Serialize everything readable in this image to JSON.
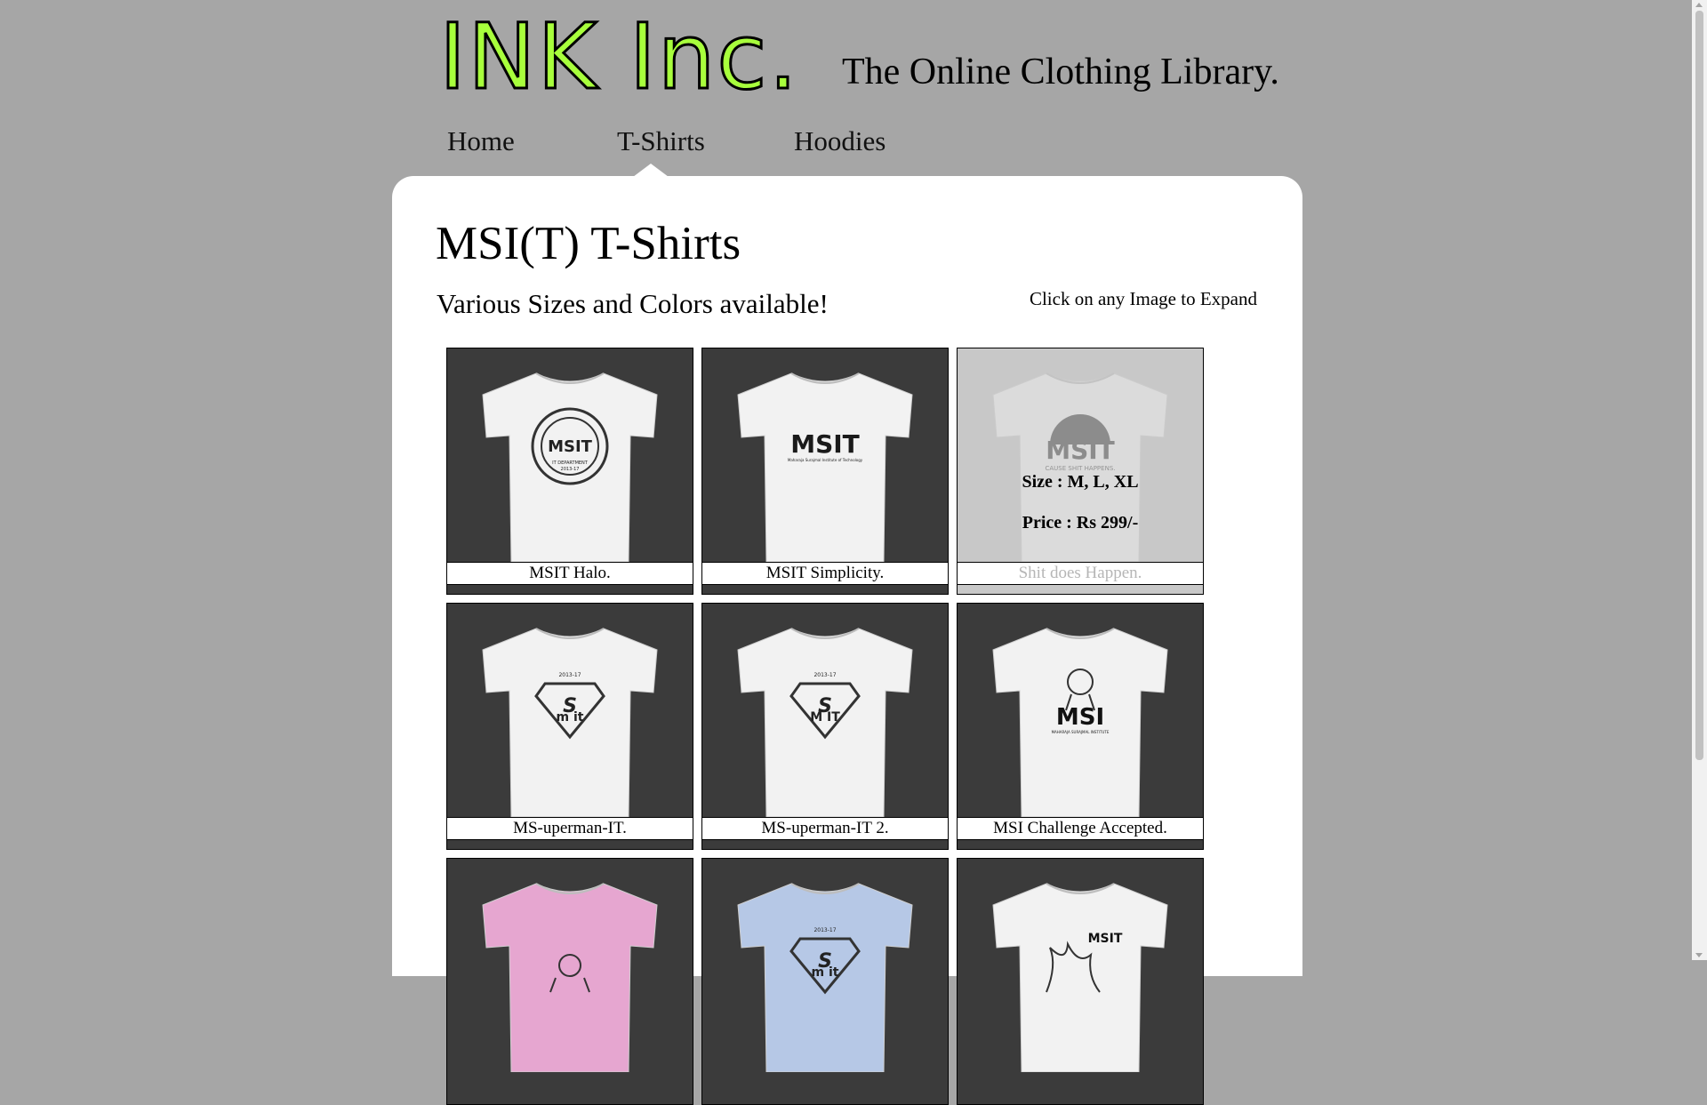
{
  "header": {
    "logo": "INK Inc.",
    "tagline": "The Online Clothing Library."
  },
  "nav": {
    "items": [
      {
        "label": "Home"
      },
      {
        "label": "T-Shirts",
        "active": true
      },
      {
        "label": "Hoodies"
      }
    ]
  },
  "main": {
    "title": "MSI(T) T-Shirts",
    "subtitle": "Various Sizes and Colors available!",
    "hint": "Click on any Image to Expand"
  },
  "gallery": {
    "items": [
      {
        "caption": "MSIT Halo.",
        "shirt_color": "#f2f2f2",
        "print": "halo"
      },
      {
        "caption": "MSIT Simplicity.",
        "shirt_color": "#f2f2f2",
        "print": "simplicity"
      },
      {
        "caption": "Shit does Happen.",
        "shirt_color": "#f2f2f2",
        "print": "happens",
        "hover": true,
        "size": "Size : M, L, XL",
        "price": "Price : Rs 299/-"
      },
      {
        "caption": "MS-uperman-IT.",
        "shirt_color": "#f2f2f2",
        "print": "superman"
      },
      {
        "caption": "MS-uperman-IT 2.",
        "shirt_color": "#f2f2f2",
        "print": "superman2"
      },
      {
        "caption": "MSI Challenge Accepted.",
        "shirt_color": "#f2f2f2",
        "print": "challenge"
      },
      {
        "caption": "",
        "shirt_color": "#e6a6d0",
        "print": "face"
      },
      {
        "caption": "",
        "shirt_color": "#b6c8e6",
        "print": "superman"
      },
      {
        "caption": "",
        "shirt_color": "#f2f2f2",
        "print": "fire"
      }
    ],
    "print_text": {
      "halo": "MSIT",
      "halo_sub": "IT DEPARTMENT",
      "halo_year": "2013-17",
      "simplicity": "MSIT",
      "simplicity_sub": "Maharaja Surajmal Institute of Technology",
      "happens": "MSIT",
      "happens_sub": "CAUSE SHIT HAPPENS.",
      "superman_year": "2013-17",
      "superman_letters": "m it",
      "superman2_letters": "M IT",
      "challenge": "MSI",
      "challenge_sub": "MAHARAJA SURAJMAL INSTITUTE",
      "fire": "MSIT",
      "shirt_year_blue": "2014-17"
    }
  },
  "colors": {
    "page_bg": "#a6a6a6",
    "logo_fill": "#a8ff3c",
    "card_bg": "#3b3b3b"
  }
}
